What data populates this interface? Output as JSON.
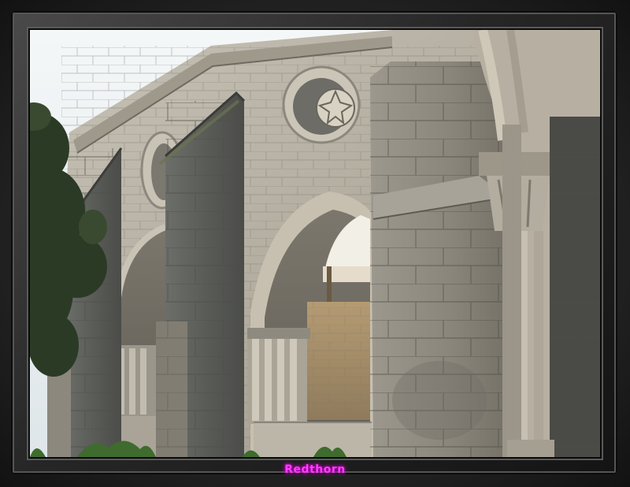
{
  "frame": {
    "signature": "Redthorn",
    "signature_color": "#ff3cff"
  },
  "photo": {
    "subject": "gothic-stone-cloister-arches",
    "palette": {
      "sky": "#e7edf0",
      "stone_light": "#b9b3a6",
      "stone_mid": "#8f8a80",
      "stone_dark": "#5d5f5c",
      "moss": "#6a7451",
      "tree": "#2d3a26",
      "interior_wall": "#a78f6b"
    }
  }
}
